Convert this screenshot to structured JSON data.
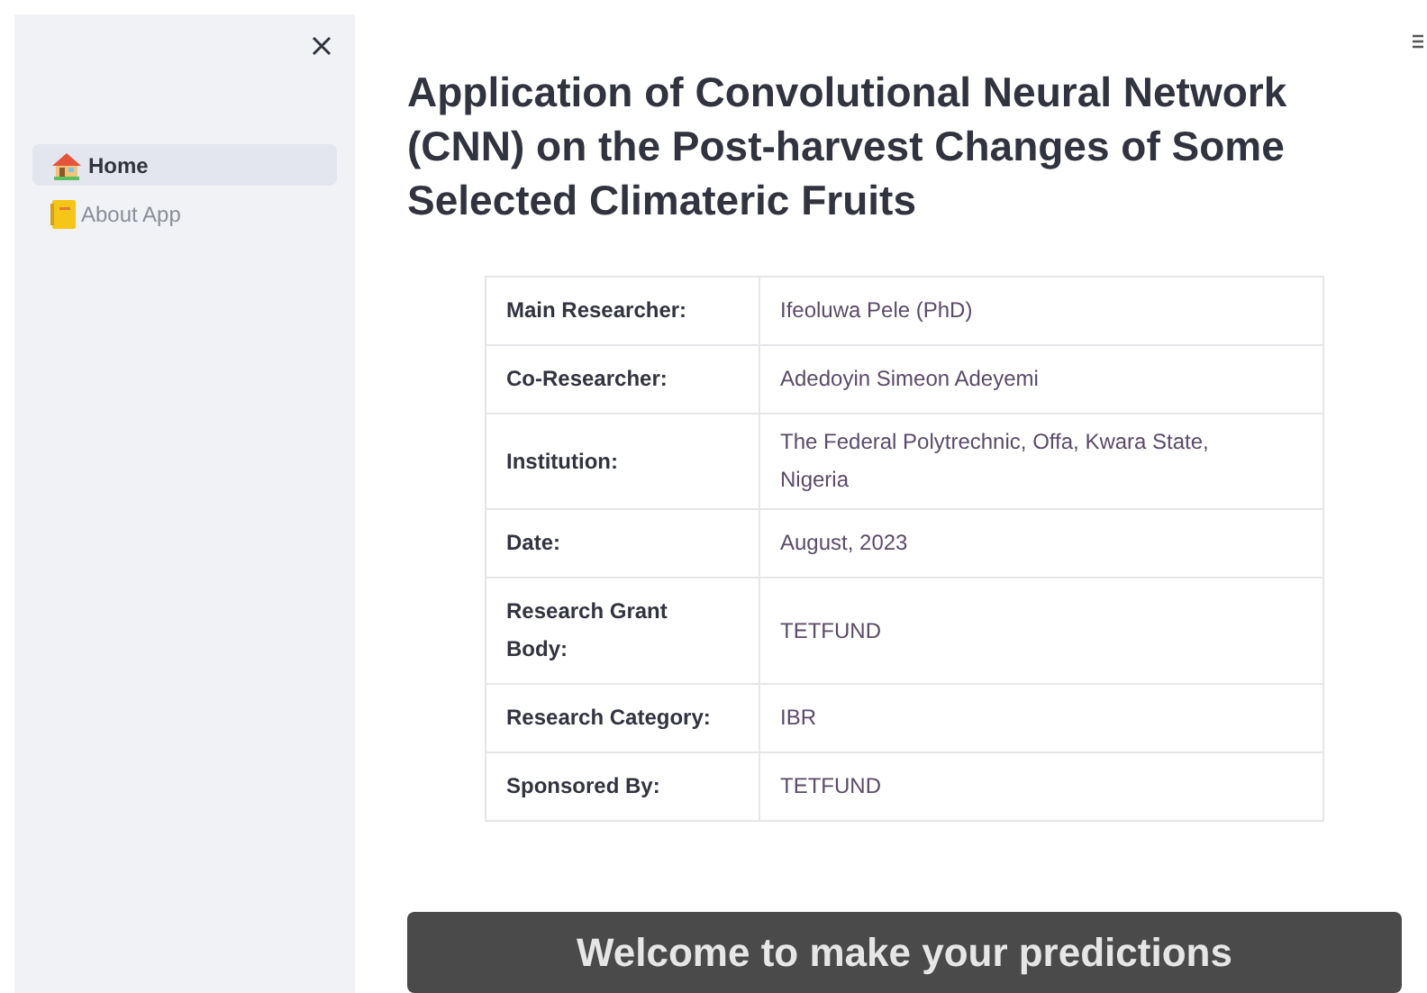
{
  "sidebar": {
    "items": [
      {
        "label": "Home",
        "kind": "house",
        "selected": true
      },
      {
        "label": "About App",
        "kind": "notebook",
        "selected": false
      }
    ]
  },
  "title": "Application of Convolutional Neural Network (CNN) on the Post-harvest Changes of Some Selected Climateric Fruits",
  "table": {
    "rows": [
      {
        "label": "Main Researcher:",
        "value": "Ifeoluwa Pele (PhD)"
      },
      {
        "label": "Co-Researcher:",
        "value": "Adedoyin Simeon Adeyemi"
      },
      {
        "label": "Institution:",
        "value": "The Federal Polytrechnic, Offa, Kwara State, Nigeria"
      },
      {
        "label": "Date:",
        "value": "August, 2023"
      },
      {
        "label": "Research Grant Body:",
        "value": "TETFUND"
      },
      {
        "label": "Research Category:",
        "value": "IBR"
      },
      {
        "label": "Sponsored By:",
        "value": "TETFUND"
      }
    ]
  },
  "banner": "Welcome to make your predictions"
}
